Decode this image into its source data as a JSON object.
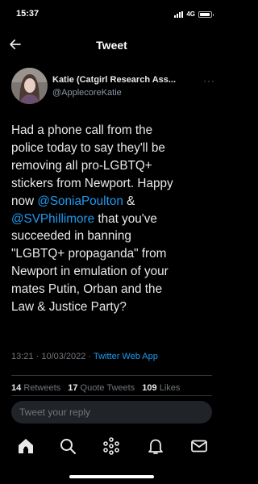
{
  "status_bar": {
    "time": "15:37",
    "network": "4G",
    "battery_level": 0.9
  },
  "nav": {
    "title": "Tweet",
    "back_icon": "back-arrow-icon"
  },
  "tweet": {
    "author": {
      "display_name": "Katie (Catgirl Research Ass...",
      "handle": "@ApplecoreKatie"
    },
    "body_lines": [
      [
        {
          "t": "Had a phone call from the",
          "m": false
        }
      ],
      [
        {
          "t": "police today to say they'll be",
          "m": false
        }
      ],
      [
        {
          "t": "removing all pro-LGBTQ+",
          "m": false
        }
      ],
      [
        {
          "t": "stickers from Newport.  Happy",
          "m": false
        }
      ],
      [
        {
          "t": "now ",
          "m": false
        },
        {
          "t": "@SoniaPoulton",
          "m": true
        },
        {
          "t": " &",
          "m": false
        }
      ],
      [
        {
          "t": "@SVPhillimore",
          "m": true
        },
        {
          "t": " that you've",
          "m": false
        }
      ],
      [
        {
          "t": "succeeded in banning",
          "m": false
        }
      ],
      [
        {
          "t": "\"LGBTQ+ propaganda\" from",
          "m": false
        }
      ],
      [
        {
          "t": "Newport in emulation of your",
          "m": false
        }
      ],
      [
        {
          "t": "mates Putin, Orban and the",
          "m": false
        }
      ],
      [
        {
          "t": "Law & Justice Party?",
          "m": false
        }
      ]
    ],
    "time": "13:21",
    "separator": "·",
    "date": "10/03/2022",
    "source": "Twitter Web App"
  },
  "stats": {
    "retweets_count": "14",
    "retweets_label": "Retweets",
    "quote_tweets_count": "17",
    "quote_tweets_label": "Quote Tweets",
    "likes_count": "109",
    "likes_label": "Likes"
  },
  "reply": {
    "placeholder": "Tweet your reply"
  },
  "tab_bar": {
    "icons": [
      "home-icon",
      "search-icon",
      "spaces-icon",
      "notifications-icon",
      "messages-icon"
    ]
  },
  "colors": {
    "background": "#000000",
    "text": "#e7e9ea",
    "muted": "#71767b",
    "link": "#1d9bf0",
    "divider": "#2f3336"
  }
}
